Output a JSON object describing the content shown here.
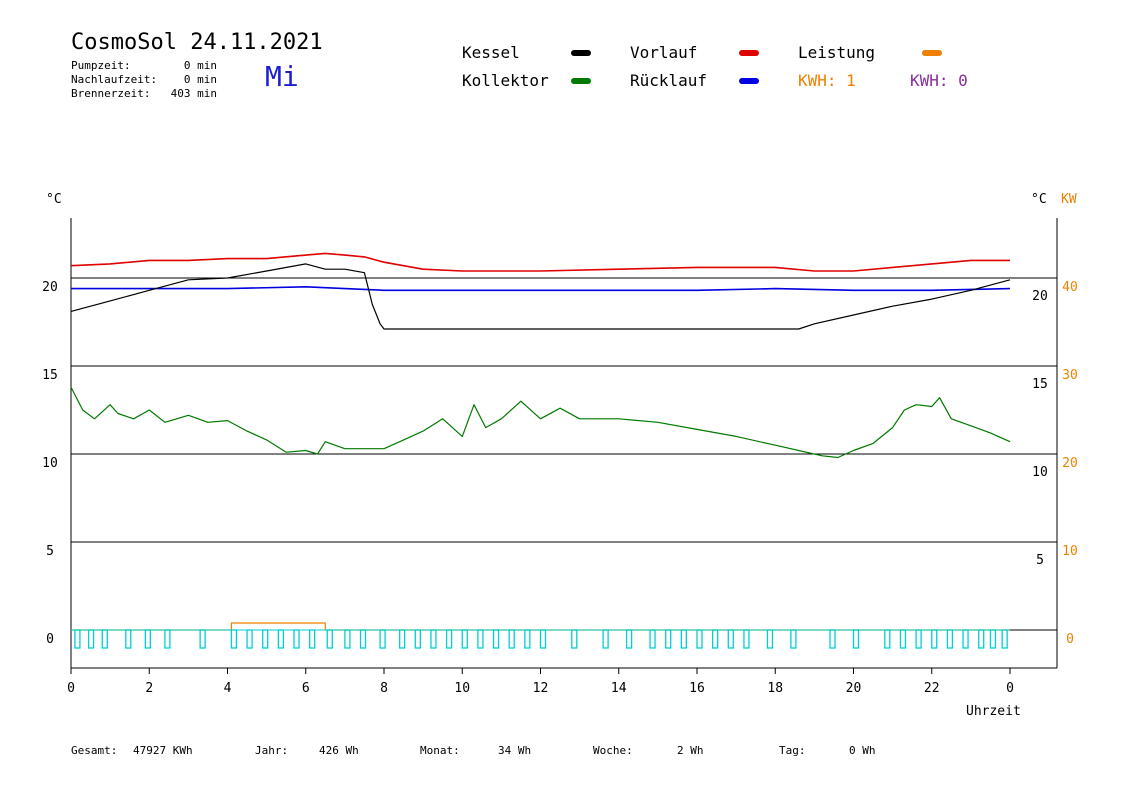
{
  "header": {
    "title": "CosmoSol 24.11.2021",
    "weekday": "Mi",
    "stats": [
      {
        "label": "Pumpzeit:",
        "value": "0 min"
      },
      {
        "label": "Nachlaufzeit:",
        "value": "0 min"
      },
      {
        "label": "Brennerzeit:",
        "value": "403 min"
      }
    ]
  },
  "legend": {
    "kessel": {
      "label": "Kessel",
      "color": "#000000"
    },
    "vorlauf": {
      "label": "Vorlauf",
      "color": "#e00000"
    },
    "leistung": {
      "label": "Leistung",
      "color": "#f08000"
    },
    "kollektor": {
      "label": "Kollektor",
      "color": "#007a00"
    },
    "ruecklauf": {
      "label": "Rücklauf",
      "color": "#0000e0"
    },
    "kwh1": {
      "label": "KWH: 1",
      "color": "#f08000"
    },
    "kwh2": {
      "label": "KWH: 0",
      "color": "#8b2c9e"
    }
  },
  "footer": {
    "gesamt": {
      "label": "Gesamt:",
      "value": "47927 KWh"
    },
    "jahr": {
      "label": "Jahr:",
      "value": "426 Wh"
    },
    "monat": {
      "label": "Monat:",
      "value": "34 Wh"
    },
    "woche": {
      "label": "Woche:",
      "value": "2 Wh"
    },
    "tag": {
      "label": "Tag:",
      "value": "0 Wh"
    }
  },
  "chart_data": {
    "type": "line",
    "xlabel": "Uhrzeit",
    "ylabel_left": "°C",
    "ylabel_right": "°C",
    "ylabel_right2": "KW",
    "xlim": [
      0,
      24
    ],
    "ylim": [
      -1.8,
      25.5
    ],
    "x_ticks": [
      0,
      2,
      4,
      6,
      8,
      10,
      12,
      14,
      16,
      18,
      20,
      22,
      24
    ],
    "x_tick_labels": [
      "0",
      "2",
      "4",
      "6",
      "8",
      "10",
      "12",
      "14",
      "16",
      "18",
      "20",
      "22",
      "0"
    ],
    "y_ticks_left": [
      0,
      5,
      10,
      15,
      20
    ],
    "y_tick_labels_left": [
      "0",
      "5",
      "10",
      "15",
      "20"
    ],
    "y_tick_labels_right": [
      "5",
      "10",
      "15",
      "20"
    ],
    "y_ticks_kw": [
      0,
      10,
      20,
      30,
      40
    ],
    "y_tick_labels_kw": [
      "0",
      "10",
      "20",
      "30",
      "40"
    ],
    "gridlines": [
      0,
      5,
      10,
      15,
      20
    ],
    "series": [
      {
        "name": "Vorlauf",
        "color": "#e00000",
        "x": [
          0,
          1,
          2,
          3,
          4,
          5,
          6,
          6.5,
          7,
          7.5,
          8,
          8.5,
          9,
          10,
          12,
          14,
          16,
          18,
          19,
          20,
          21,
          22,
          23,
          24
        ],
        "y": [
          20.7,
          20.8,
          21.0,
          21.0,
          21.1,
          21.1,
          21.3,
          21.4,
          21.3,
          21.2,
          20.9,
          20.7,
          20.5,
          20.4,
          20.4,
          20.5,
          20.6,
          20.6,
          20.4,
          20.4,
          20.6,
          20.8,
          21.0,
          21.0
        ]
      },
      {
        "name": "Rücklauf",
        "color": "#0000e0",
        "x": [
          0,
          2,
          4,
          6,
          7,
          8,
          10,
          12,
          14,
          16,
          18,
          20,
          22,
          24
        ],
        "y": [
          19.4,
          19.4,
          19.4,
          19.5,
          19.4,
          19.3,
          19.3,
          19.3,
          19.3,
          19.3,
          19.4,
          19.3,
          19.3,
          19.4
        ]
      },
      {
        "name": "Kessel",
        "color": "#000000",
        "x": [
          0,
          1,
          2,
          3,
          4,
          5,
          6,
          6.5,
          7,
          7.5,
          7.7,
          7.9,
          8,
          10,
          12,
          14,
          16,
          18,
          18.6,
          19,
          20,
          21,
          22,
          23,
          24
        ],
        "y": [
          18.1,
          18.7,
          19.3,
          19.9,
          20.0,
          20.4,
          20.8,
          20.5,
          20.5,
          20.3,
          18.5,
          17.4,
          17.1,
          17.1,
          17.1,
          17.1,
          17.1,
          17.1,
          17.1,
          17.4,
          17.9,
          18.4,
          18.8,
          19.3,
          19.9
        ]
      },
      {
        "name": "Kollektor",
        "color": "#007a00",
        "x": [
          0,
          0.3,
          0.6,
          1.0,
          1.2,
          1.6,
          2.0,
          2.4,
          3.0,
          3.5,
          4.0,
          4.5,
          5.0,
          5.5,
          6.0,
          6.3,
          6.5,
          7.0,
          8.0,
          8.5,
          9.0,
          9.5,
          10.0,
          10.3,
          10.6,
          11.0,
          11.5,
          12.0,
          12.5,
          13.0,
          14.0,
          15.0,
          16.0,
          17.0,
          18.0,
          18.6,
          19.2,
          19.6,
          20.0,
          20.5,
          21.0,
          21.3,
          21.6,
          22.0,
          22.2,
          22.5,
          23.0,
          23.5,
          24.0
        ],
        "y": [
          13.8,
          12.5,
          12.0,
          12.8,
          12.3,
          12.0,
          12.5,
          11.8,
          12.2,
          11.8,
          11.9,
          11.3,
          10.8,
          10.1,
          10.2,
          10.0,
          10.7,
          10.3,
          10.3,
          10.8,
          11.3,
          12.0,
          11.0,
          12.8,
          11.5,
          12.0,
          13.0,
          12.0,
          12.6,
          12.0,
          12.0,
          11.8,
          11.4,
          11.0,
          10.5,
          10.2,
          9.9,
          9.8,
          10.2,
          10.6,
          11.5,
          12.5,
          12.8,
          12.7,
          13.2,
          12.0,
          11.6,
          11.2,
          10.7
        ]
      },
      {
        "name": "Leistung",
        "color": "#f08000",
        "x": [
          0,
          4.1,
          4.1,
          6.5,
          6.5,
          24
        ],
        "y": [
          0,
          0,
          0.4,
          0.4,
          0,
          0
        ]
      }
    ],
    "pump_pulses": {
      "color": "#00d0d0",
      "x": [
        0.1,
        0.45,
        0.8,
        1.4,
        1.9,
        2.4,
        3.3,
        4.1,
        4.5,
        4.9,
        5.3,
        5.7,
        6.1,
        6.55,
        7.0,
        7.4,
        7.9,
        8.4,
        8.8,
        9.2,
        9.6,
        10.0,
        10.4,
        10.8,
        11.2,
        11.6,
        12.0,
        12.8,
        13.6,
        14.2,
        14.8,
        15.2,
        15.6,
        16.0,
        16.4,
        16.8,
        17.2,
        17.8,
        18.4,
        19.4,
        20.0,
        20.8,
        21.2,
        21.6,
        22.0,
        22.4,
        22.8,
        23.2,
        23.5,
        23.8
      ]
    }
  }
}
